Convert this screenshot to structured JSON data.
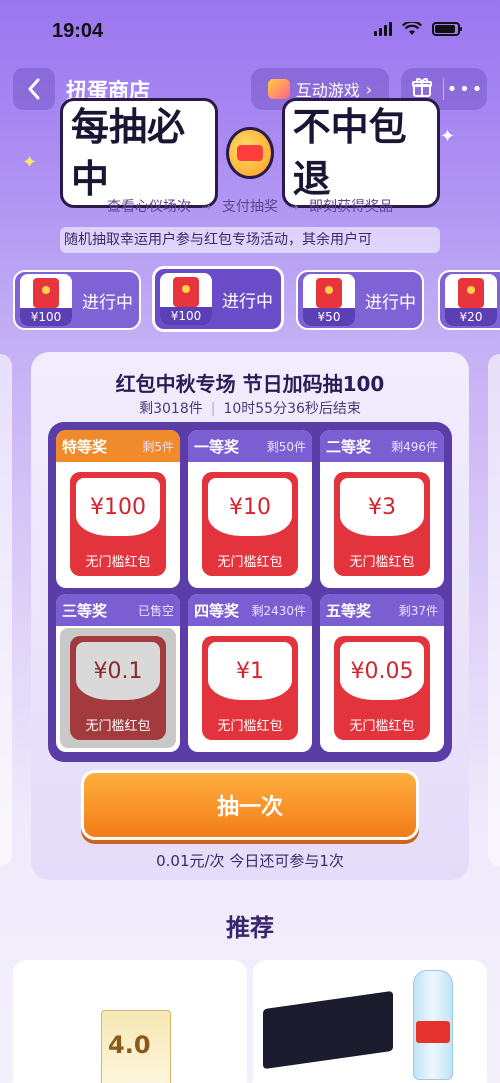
{
  "status_bar": {
    "time": "19:04"
  },
  "nav": {
    "title": "扭蛋商店",
    "game_button": "互动游戏",
    "back_icon": "chevron-left-icon",
    "gift_icon": "gift-icon",
    "more_icon": "more-dots-icon"
  },
  "banner": {
    "title_left": "每抽必中",
    "title_right": "不中包退",
    "steps": [
      "查看心仪场次",
      "支付抽奖",
      "即刻获得奖品"
    ],
    "notice": "随机抽取幸运用户参与红包专场活动，其余用户可"
  },
  "tabs": [
    {
      "amount": "¥100",
      "status": "进行中",
      "active": false
    },
    {
      "amount": "¥100",
      "status": "进行中",
      "active": true
    },
    {
      "amount": "¥50",
      "status": "进行中",
      "active": false
    },
    {
      "amount": "¥20",
      "status": "",
      "active": false
    }
  ],
  "event": {
    "title": "红包中秋专场 节日加码抽100",
    "remaining": "剩3018件",
    "countdown": "10时55分36秒后结束"
  },
  "prizes": [
    {
      "name": "特等奖",
      "left": "剩5件",
      "value": "¥100",
      "label": "无门槛红包",
      "type": "special"
    },
    {
      "name": "一等奖",
      "left": "剩50件",
      "value": "¥10",
      "label": "无门槛红包",
      "type": "normal"
    },
    {
      "name": "二等奖",
      "left": "剩496件",
      "value": "¥3",
      "label": "无门槛红包",
      "type": "normal"
    },
    {
      "name": "三等奖",
      "left": "已售空",
      "value": "¥0.1",
      "label": "无门槛红包",
      "type": "soldout"
    },
    {
      "name": "四等奖",
      "left": "剩2430件",
      "value": "¥1",
      "label": "无门槛红包",
      "type": "normal"
    },
    {
      "name": "五等奖",
      "left": "剩37件",
      "value": "¥0.05",
      "label": "无门槛红包",
      "type": "normal"
    }
  ],
  "draw": {
    "button": "抽一次",
    "note": "0.01元/次 今日还可参与1次"
  },
  "recommend": {
    "title": "推荐"
  },
  "colors": {
    "accent_purple": "#6a4cc8",
    "prize_red": "#e3333c",
    "draw_orange": "#f27d18",
    "special_orange": "#f08a2a"
  }
}
